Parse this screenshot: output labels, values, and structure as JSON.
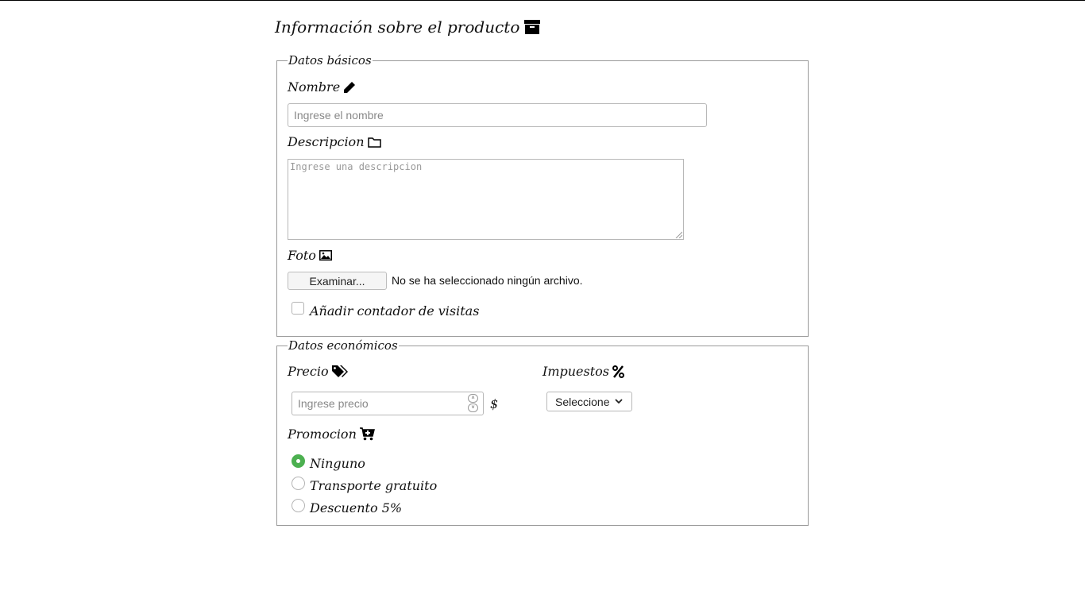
{
  "title": "Información sobre el producto",
  "basic": {
    "legend": "Datos básicos",
    "nombre_label": "Nombre",
    "nombre_placeholder": "Ingrese el nombre",
    "descripcion_label": "Descripcion",
    "descripcion_placeholder": "Ingrese una descripcion",
    "foto_label": "Foto",
    "file_button": "Examinar...",
    "file_status": "No se ha seleccionado ningún archivo.",
    "counter_label": "Añadir contador de visitas",
    "counter_checked": false
  },
  "economic": {
    "legend": "Datos económicos",
    "precio_label": "Precio",
    "precio_placeholder": "Ingrese precio",
    "currency": "$",
    "impuestos_label": "Impuestos",
    "impuestos_selected": "Seleccione",
    "promocion_label": "Promocion",
    "promociones": [
      {
        "label": "Ninguno",
        "checked": true
      },
      {
        "label": "Transporte gratuito",
        "checked": false
      },
      {
        "label": "Descuento 5%",
        "checked": false
      }
    ]
  },
  "colors": {
    "radio_accent": "#4cb050",
    "border": "#9a9a9a"
  },
  "icons": [
    "archive-icon",
    "pencil-icon",
    "folder-icon",
    "image-icon",
    "tags-icon",
    "percent-icon",
    "cart-plus-icon",
    "chevron-down-icon"
  ]
}
